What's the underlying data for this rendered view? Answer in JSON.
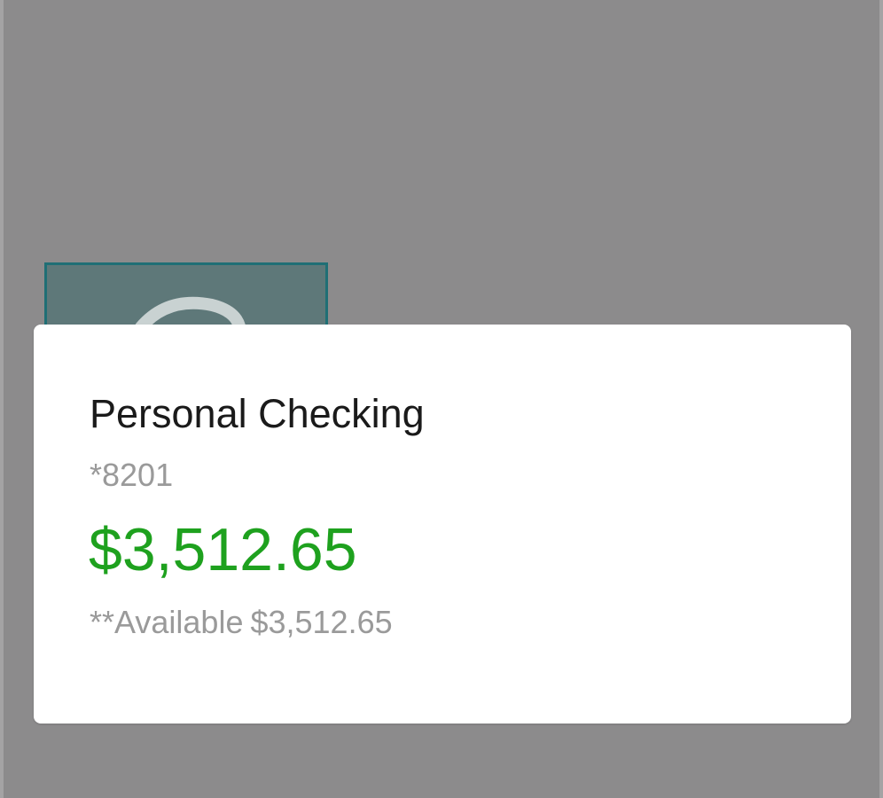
{
  "account": {
    "name": "Personal Checking",
    "number": "*8201",
    "balance": "$3,512.65",
    "available_label": "**Available",
    "available_amount": "$3,512.65"
  },
  "icons": {
    "account_tile_icon": "bank-icon"
  },
  "colors": {
    "background_overlay": "#8c8b8c",
    "card_background": "#ffffff",
    "balance_positive": "#1ea11e",
    "secondary_text": "#9a9a9a",
    "primary_text": "#1a1a1a",
    "tile_border": "#1f6f75",
    "tile_fill": "#5e7879"
  }
}
